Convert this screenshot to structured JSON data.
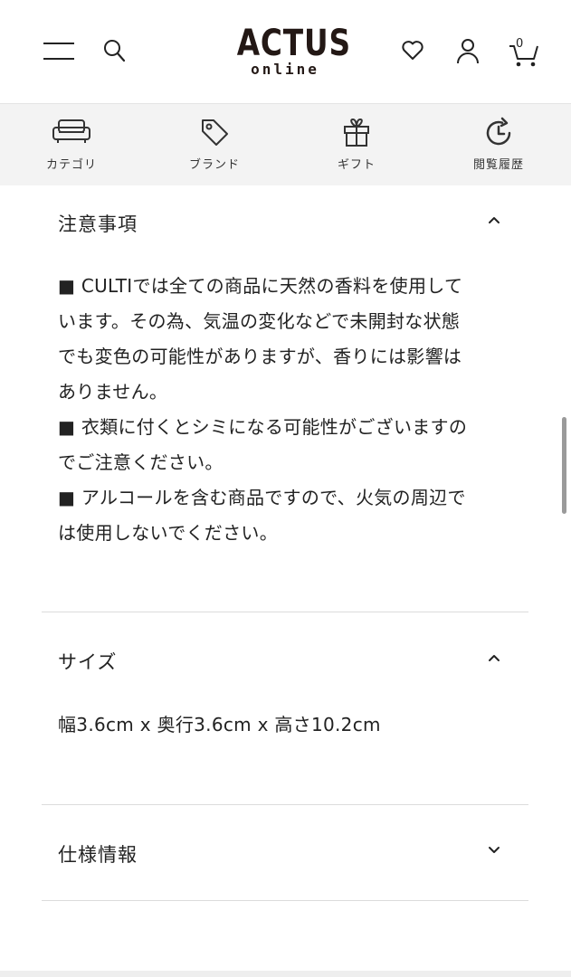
{
  "header": {
    "logo_main": "ACTUS",
    "logo_sub": "online",
    "cart_count": "0",
    "icons": [
      "menu-icon",
      "search-icon",
      "heart-icon",
      "user-icon",
      "cart-icon"
    ]
  },
  "category_nav": {
    "items": [
      {
        "label": "カテゴリ",
        "icon": "sofa-icon"
      },
      {
        "label": "ブランド",
        "icon": "tag-icon"
      },
      {
        "label": "ギフト",
        "icon": "gift-icon"
      },
      {
        "label": "閲覧履歴",
        "icon": "history-icon"
      }
    ]
  },
  "sections": [
    {
      "title": "注意事項",
      "expanded": true,
      "lines": [
        "■ CULTIでは全ての商品に天然の香料を使用して",
        "います。その為、気温の変化などで未開封な状態",
        "でも変色の可能性がありますが、香りには影響は",
        "ありません。",
        "■ 衣類に付くとシミになる可能性がございますの",
        "でご注意ください。",
        "■ アルコールを含む商品ですので、火気の周辺で",
        "は使用しないでください。"
      ]
    },
    {
      "title": "サイズ",
      "expanded": true,
      "lines": [
        "幅3.6cm x 奥行3.6cm x 高さ10.2cm"
      ]
    },
    {
      "title": "仕様情報",
      "expanded": false,
      "lines": []
    }
  ],
  "colors": {
    "text": "#222222",
    "nav_background": "#f3f3f3",
    "divider": "#dcdcdc"
  }
}
